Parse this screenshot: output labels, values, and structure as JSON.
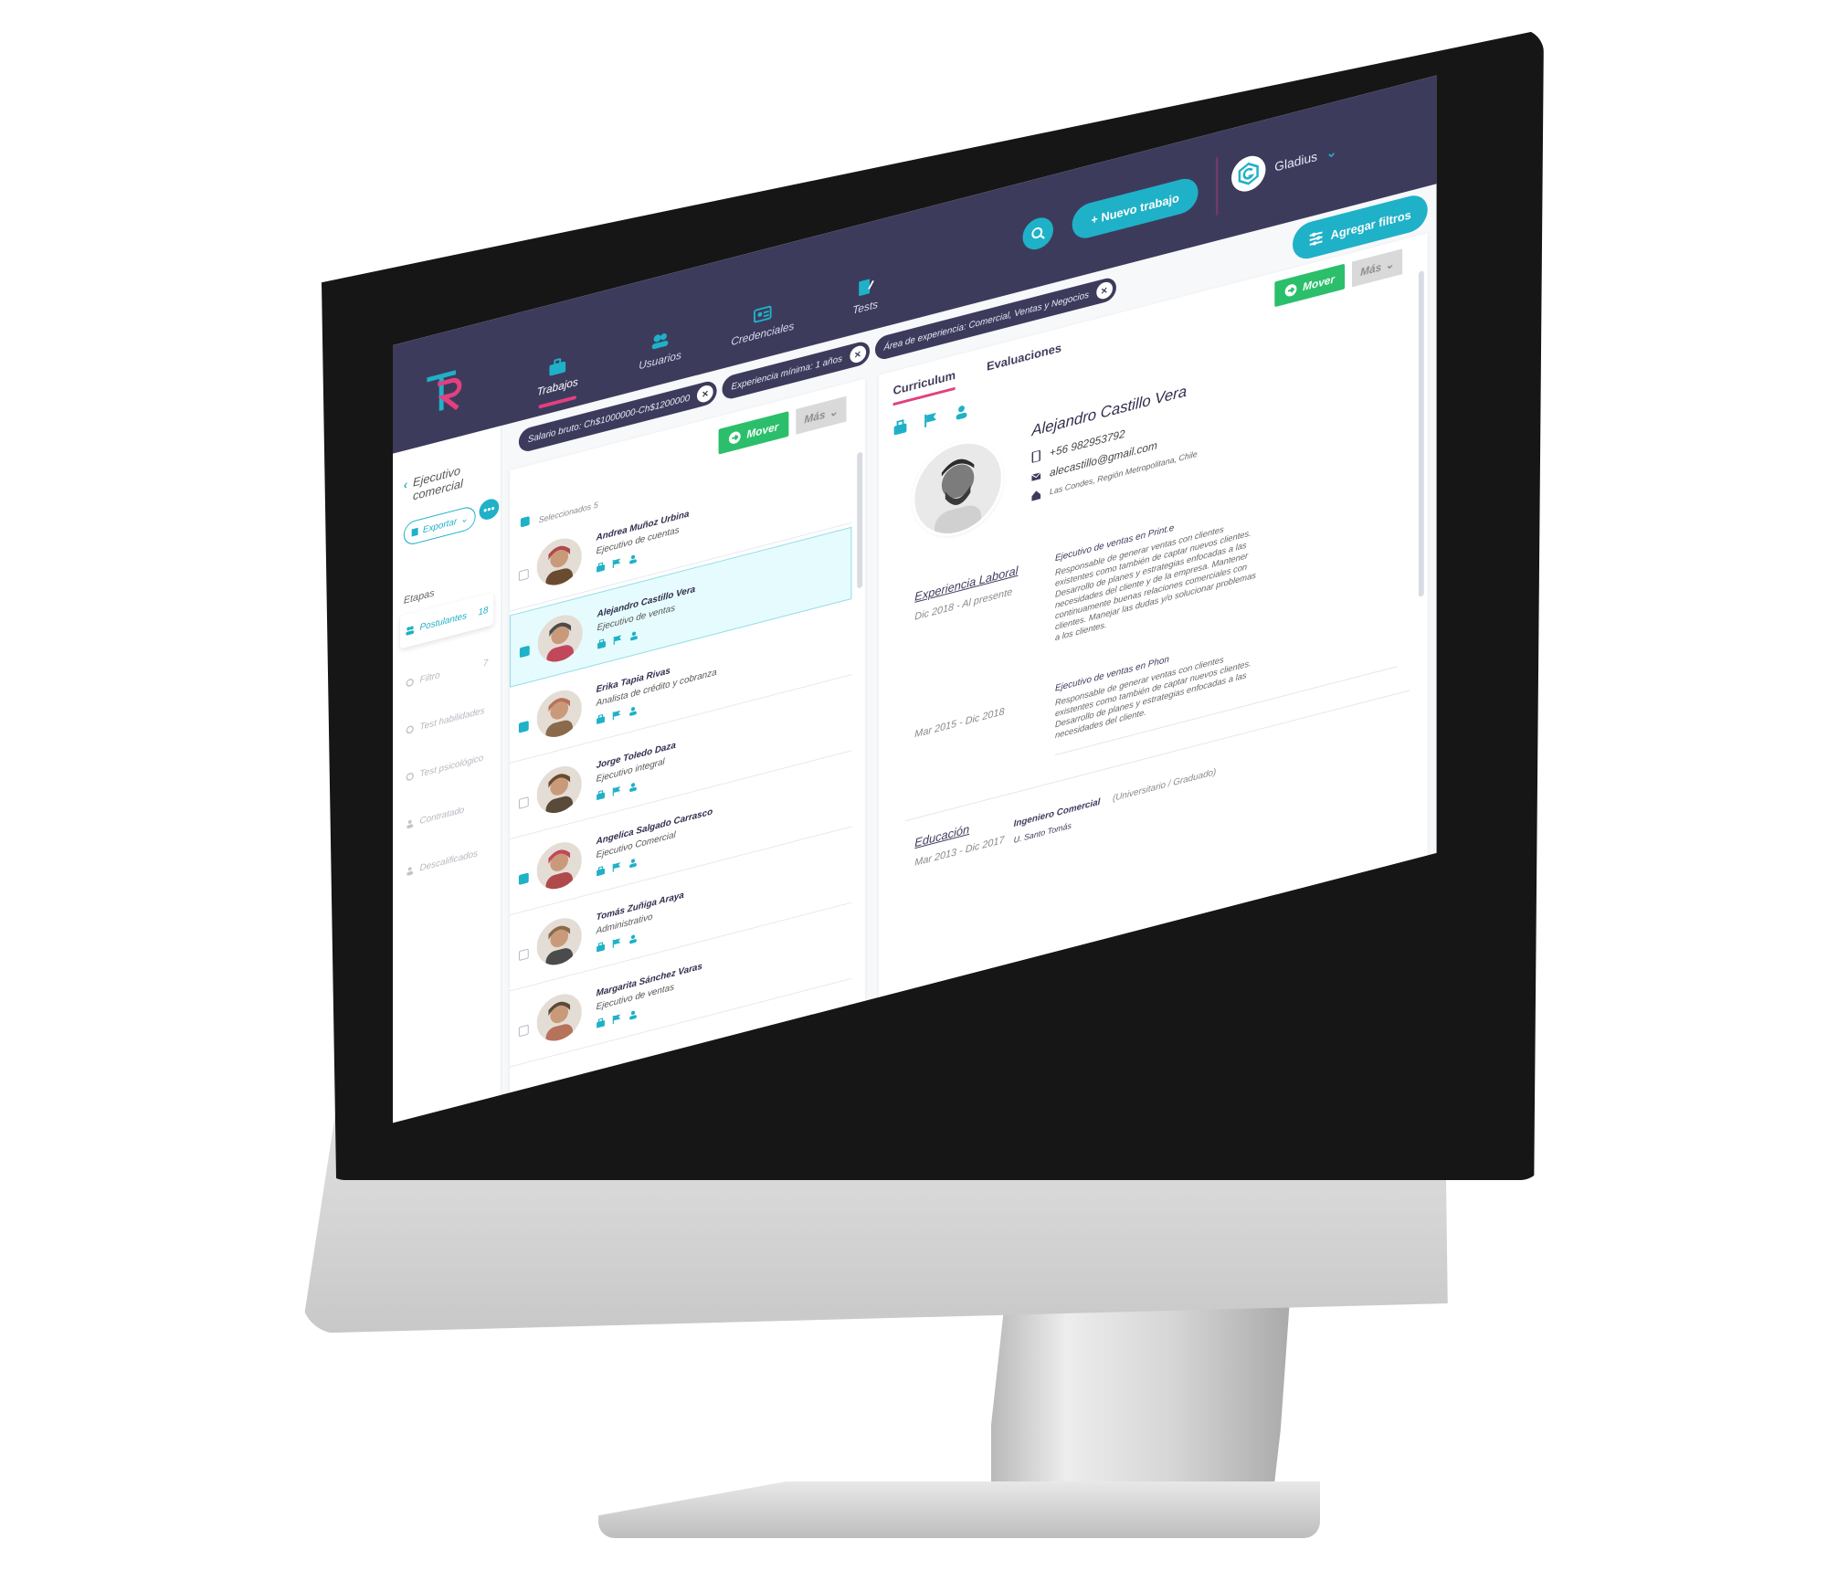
{
  "app": {
    "nav": [
      {
        "label": "Trabajos",
        "icon": "briefcase-icon",
        "active": true
      },
      {
        "label": "Usuarios",
        "icon": "users-icon",
        "active": false
      },
      {
        "label": "Credenciales",
        "icon": "id-card-icon",
        "active": false
      },
      {
        "label": "Tests",
        "icon": "test-icon",
        "active": false
      }
    ],
    "new_job_label": "+ Nuevo trabajo",
    "user_name": "Gladius",
    "add_filters_label": "Agregar filtros"
  },
  "chips": [
    {
      "label": "Salario bruto: Ch$1000000-Ch$1200000"
    },
    {
      "label": "Experiencia mínima: 1 años"
    },
    {
      "label": "Área de experiencia: Comercial, Ventas y Negocios"
    }
  ],
  "sidebar": {
    "job_title": "Ejecutivo comercial",
    "export_label": "Exportar",
    "stages_label": "Etapas",
    "stages": [
      {
        "label": "Postulantes",
        "count": "18",
        "active": true,
        "icon": "users-icon"
      },
      {
        "label": "Filtro",
        "count": "7",
        "active": false,
        "icon": "circle-icon"
      },
      {
        "label": "Test habilidades",
        "count": "",
        "active": false,
        "icon": "circle-icon"
      },
      {
        "label": "Test psicológico",
        "count": "",
        "active": false,
        "icon": "circle-icon"
      },
      {
        "label": "Contratado",
        "count": "",
        "active": false,
        "icon": "user-icon"
      },
      {
        "label": "Descalificados",
        "count": "",
        "active": false,
        "icon": "user-icon"
      }
    ]
  },
  "list": {
    "move_label": "Mover",
    "more_label": "Más",
    "selected_label": "Seleccionados 5",
    "candidates": [
      {
        "name": "Andrea Muñoz Urbina",
        "role": "Ejecutivo de cuentas",
        "checked": false,
        "active": false
      },
      {
        "name": "Alejandro Castillo Vera",
        "role": "Ejecutivo de ventas",
        "checked": true,
        "active": true
      },
      {
        "name": "Erika Tapia Rivas",
        "role": "Analista de crédito y cobranza",
        "checked": true,
        "active": false
      },
      {
        "name": "Jorge Toledo Daza",
        "role": "Ejecutivo integral",
        "checked": false,
        "active": false
      },
      {
        "name": "Angelica Salgado Carrasco",
        "role": "Ejecutivo Comercial",
        "checked": true,
        "active": false
      },
      {
        "name": "Tomás Zuñiga Araya",
        "role": "Administrativo",
        "checked": false,
        "active": false
      },
      {
        "name": "Margarita Sánchez Varas",
        "role": "Ejecutivo de ventas",
        "checked": false,
        "active": false
      }
    ]
  },
  "detail": {
    "tabs": [
      "Curriculum",
      "Evaluaciones"
    ],
    "move_label": "Mover",
    "more_label": "Más",
    "name": "Alejandro Castillo Vera",
    "phone": "+56 982953792",
    "email": "alecastillo@gmail.com",
    "address": "Las Condes, Región Metropolitana, Chile",
    "experience_title": "Experiencia Laboral",
    "experience": [
      {
        "dates": "Dic 2018 - Al presente",
        "title": "Ejecutivo de ventas en Print.e",
        "desc": "Responsable de generar ventas con clientes existentes como también de captar nuevos clientes. Desarrollo de planes y estrategias enfocadas a las necesidades del cliente y de la empresa. Mantener continuamente buenas relaciones comerciales con clientes. Manejar las dudas y/o solucionar problemas a los clientes."
      },
      {
        "dates": "Mar 2015 - Dic 2018",
        "title": "Ejecutivo de ventas en Phon",
        "desc": "Responsable de generar ventas con clientes existentes como también de captar nuevos clientes. Desarrollo de planes y estrategias enfocadas a las necesidades del cliente."
      }
    ],
    "education_title": "Educación",
    "education": {
      "dates": "Mar 2013 - Dic 2017",
      "degree": "Ingeniero Comercial",
      "level": "(Universitario / Graduado)",
      "school": "U. Santo Tomás"
    }
  },
  "colors": {
    "topbar": "#3d3b5c",
    "accent": "#1fb1c7",
    "pink": "#e2407f",
    "green": "#2bbf6b"
  }
}
